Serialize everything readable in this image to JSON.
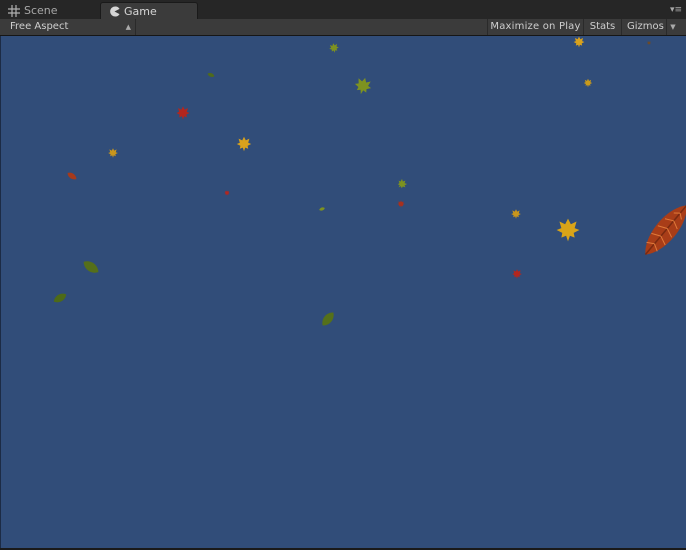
{
  "tabs": {
    "scene_label": "Scene",
    "game_label": "Game"
  },
  "toolbar": {
    "aspect_label": "Free Aspect",
    "maximize_label": "Maximize on Play",
    "stats_label": "Stats",
    "gizmos_label": "Gizmos"
  },
  "icons": {
    "scene": "grid-icon",
    "game": "pacman-icon",
    "tab_menu": "menu-icon",
    "aspect_dropdown": "up-down-arrows-icon",
    "gizmos_dropdown": "chevron-down-icon"
  },
  "colors": {
    "viewport_background": "#314d79",
    "leaf_yellow": "#d9a21c",
    "leaf_green": "#6f8a1e",
    "leaf_red": "#b3261e",
    "leaf_orange": "#b8441c"
  }
}
